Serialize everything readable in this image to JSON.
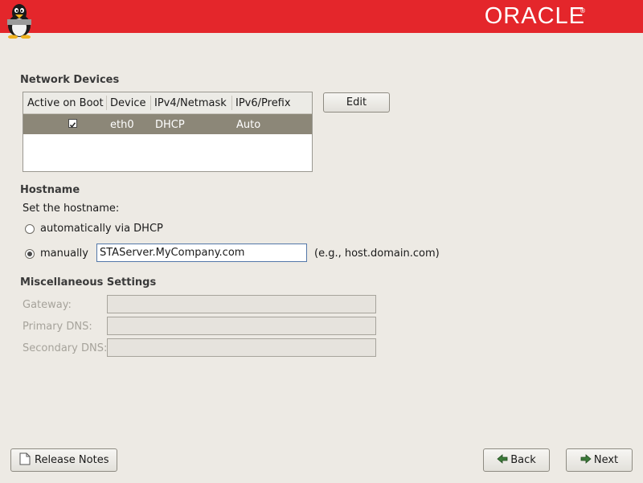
{
  "header": {
    "brand": "ORACLE",
    "reg_mark": "®",
    "brand_color": "#e4262b"
  },
  "network_devices": {
    "title": "Network Devices",
    "columns": [
      "Active on Boot",
      "Device",
      "IPv4/Netmask",
      "IPv6/Prefix"
    ],
    "rows": [
      {
        "active": true,
        "device": "eth0",
        "ipv4": "DHCP",
        "ipv6": "Auto"
      }
    ],
    "edit_button": "Edit"
  },
  "hostname": {
    "title": "Hostname",
    "prompt": "Set the hostname:",
    "option_dhcp": "automatically via DHCP",
    "option_manual": "manually",
    "selected": "manual",
    "value": "STAServer.MyCompany.com",
    "hint": "(e.g., host.domain.com)"
  },
  "misc": {
    "title": "Miscellaneous Settings",
    "gateway_label": "Gateway:",
    "primary_dns_label": "Primary DNS:",
    "secondary_dns_label": "Secondary DNS:"
  },
  "footer": {
    "release_notes": "Release Notes",
    "back": "Back",
    "next": "Next"
  }
}
